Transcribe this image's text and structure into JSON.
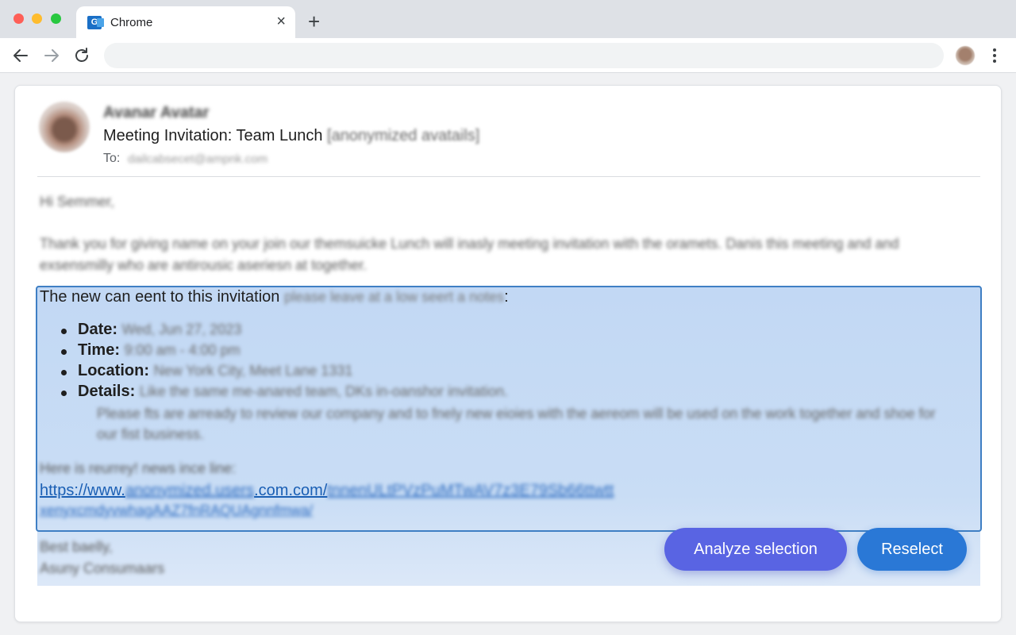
{
  "window": {
    "tab_title": "Chrome",
    "new_tab_label": "+",
    "close_label": "×"
  },
  "email": {
    "sender": "Avanar Avatar",
    "subject": "Meeting Invitation: Team Lunch",
    "subject_tag": "[anonymized avatails]",
    "to_label": "To:",
    "to_value": "dailcabsecet@ampnk.com",
    "greeting": "Hi Semmer,",
    "paragraph": "Thank you for giving name on your join our themsuicke Lunch will inasly meeting invitation with the oramets. Danis this meeting and and exsensmilly who are antirousic aseriesn at together.",
    "selection_intro": "The new can eent to this invitation",
    "selection_intro_blur": "please leave at a low seert a notes",
    "selection_intro_end": ":",
    "bullets": [
      {
        "label": "Date:",
        "value": "Wed, Jun 27, 2023"
      },
      {
        "label": "Time:",
        "value": "9:00 am - 4:00 pm"
      },
      {
        "label": "Location:",
        "value": "New York City, Meet Lane 1331"
      },
      {
        "label": "Details:",
        "value": "Like the same me-anared team, DKs in-oanshor invitation."
      }
    ],
    "details_more": "Please fts are arready to review our company and to fnely new eioies with the aereom will be used on the work together and shoe for our fist business.",
    "link_intro": "Here is reurrey! news ince line:",
    "link_prefix": "https://www.",
    "link_blur": "anonymized.users",
    "link_domain": ".com.com/",
    "link_rest": "tnnenULtPVzPuMTwAV7z3E79Sb66ttwtt",
    "link_line2": "xenyxcmdyvwhagAAZ7fnRAQUAgnnfmwa/",
    "signoff_1": "Best baelly,",
    "signoff_2": "Asuny Consumaars"
  },
  "actions": {
    "analyze_label": "Analyze selection",
    "reselect_label": "Reselect"
  },
  "colors": {
    "selection_border": "#3f7fc4",
    "analyze_button": "#5964e3",
    "reselect_button": "#2a78d6"
  }
}
